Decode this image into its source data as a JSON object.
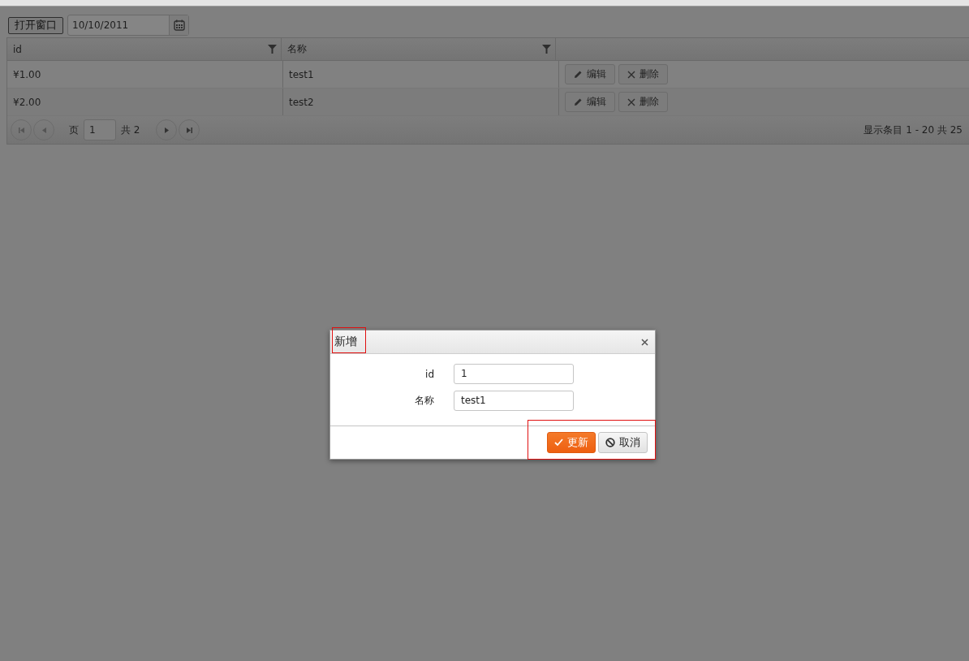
{
  "toolbar": {
    "button": "打开窗口",
    "date_field": {
      "value": "10/10/2011"
    }
  },
  "grid": {
    "columns": [
      {
        "label": "id",
        "filterable": true
      },
      {
        "label": "名称",
        "filterable": true
      }
    ],
    "rows": [
      {
        "cells": [
          "¥1.00",
          "test1"
        ],
        "actions": [
          "编辑",
          "删除"
        ]
      },
      {
        "cells": [
          "¥2.00",
          "test2"
        ],
        "actions": [
          "编辑",
          "删除"
        ]
      }
    ],
    "pager": {
      "page_label": "页",
      "page": "1",
      "total": "共 2",
      "summary": "显示条目 1 - 20 共 25"
    }
  },
  "dialog": {
    "title": "新增",
    "fields": [
      {
        "label": "id",
        "value": "1"
      },
      {
        "label": "名称",
        "value": "test1"
      }
    ],
    "buttons": [
      {
        "label": "更新",
        "kind": "primary"
      },
      {
        "label": "取消",
        "kind": "cancel"
      }
    ]
  }
}
